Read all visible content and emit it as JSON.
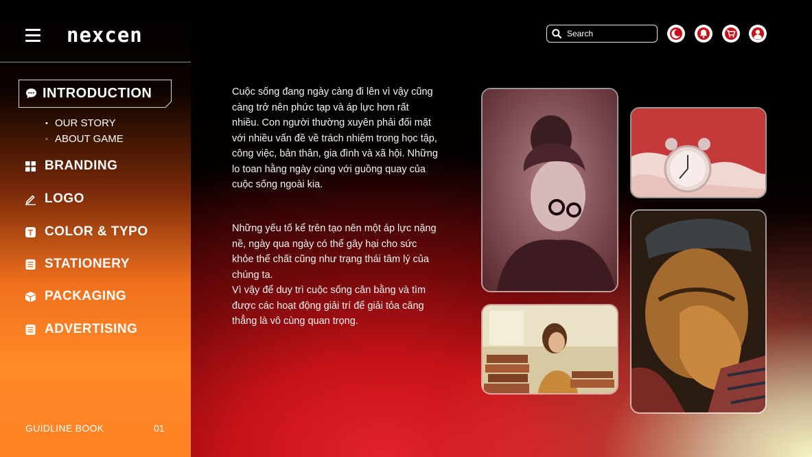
{
  "header": {
    "brand": "nexcen",
    "search_placeholder": "Search",
    "actions": [
      {
        "name": "theme-toggle",
        "icon": "moon-icon"
      },
      {
        "name": "notifications",
        "icon": "bell-icon"
      },
      {
        "name": "cart",
        "icon": "cart-icon"
      },
      {
        "name": "profile",
        "icon": "user-icon"
      }
    ]
  },
  "sidebar": {
    "active": {
      "label": "INTRODUCTION",
      "icon": "chat-bubble-icon"
    },
    "sub_items": [
      {
        "label": "OUR STORY",
        "bullet": "•"
      },
      {
        "label": "ABOUT GAME",
        "bullet": "◦"
      }
    ],
    "items": [
      {
        "label": "BRANDING",
        "icon": "grid-icon"
      },
      {
        "label": "LOGO",
        "icon": "pen-icon"
      },
      {
        "label": "COLOR & TYPO",
        "icon": "text-icon"
      },
      {
        "label": "STATIONERY",
        "icon": "document-icon"
      },
      {
        "label": "PACKAGING",
        "icon": "box-icon"
      },
      {
        "label": "ADVERTISING",
        "icon": "list-icon"
      }
    ],
    "footer": {
      "label": "GUIDLINE BOOK",
      "page": "01"
    }
  },
  "content": {
    "paragraph1": "Cuộc sống đang ngày càng đi lên vì vậy cũng càng trở nên phức tạp và áp lực hơn rất nhiều. Con người thường xuyên phải đối mặt với nhiều vấn đề về trách nhiệm trong học tập, công việc, bản thân, gia đình và xã hội. Những lo toan hằng ngày cùng với guồng quay của cuộc sống ngoài kia.",
    "paragraph2": "Những yếu tố kể trên tạo nên một áp lực nặng nề, ngày qua ngày có thể gây hại cho sức khỏe thể chất cũng như trạng thái tâm lý của chúng ta.",
    "paragraph3": "Vì vậy để duy trì cuộc sống cân bằng và tìm được các hoạt động giải trí để giải tỏa căng thẳng là vô cùng quan trọng."
  },
  "colors": {
    "accent_orange": "#ff8124",
    "accent_red": "#d91a20",
    "background": "#000000"
  }
}
